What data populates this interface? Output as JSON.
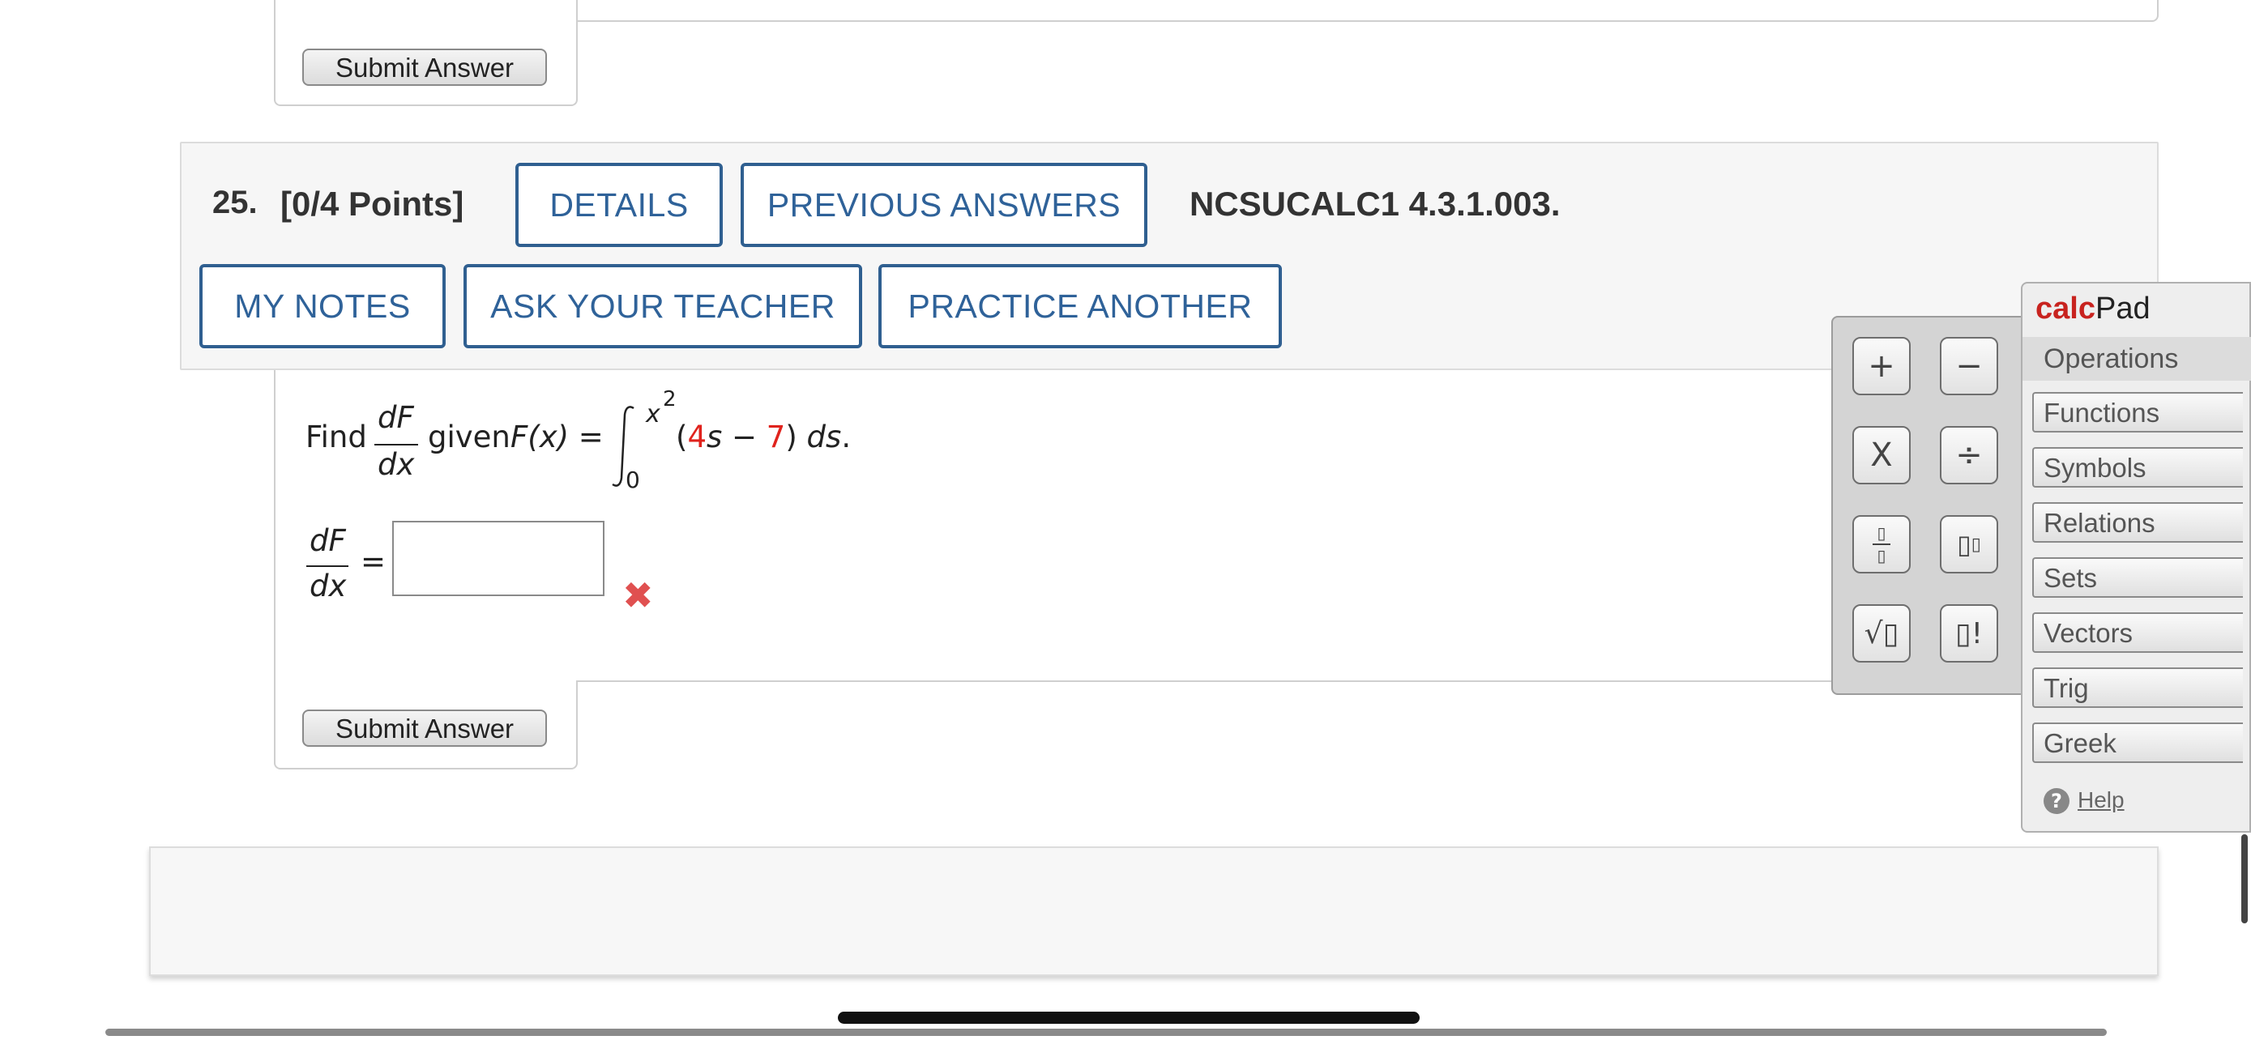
{
  "prev": {
    "submit_label": "Submit Answer"
  },
  "question": {
    "number": "25.",
    "points": "[0/4 Points]",
    "code": "NCSUCALC1 4.3.1.003.",
    "buttons": {
      "details": "DETAILS",
      "previous_answers": "PREVIOUS ANSWERS",
      "my_notes": "MY NOTES",
      "ask_teacher": "ASK YOUR TEACHER",
      "practice_another": "PRACTICE ANOTHER"
    },
    "prompt": {
      "find": "Find",
      "dF": "dF",
      "dx": "dx",
      "given": "given",
      "Fx": "F(x) =",
      "upper": "x",
      "upper_exp": "2",
      "lower": "0",
      "open": "(",
      "coef": "4",
      "var": "s",
      "minus": " − ",
      "const": "7",
      "close": ")",
      "ds": "ds",
      "period": "."
    },
    "answer": {
      "lhs_num": "dF",
      "lhs_den": "dx",
      "equals": "=",
      "value": "",
      "status": "incorrect"
    },
    "submit_label": "Submit Answer"
  },
  "calcpad": {
    "title_bold": "calc",
    "title_rest": "Pad",
    "active_tab": "Operations",
    "menu": [
      "Functions",
      "Symbols",
      "Relations",
      "Sets",
      "Vectors",
      "Trig",
      "Greek"
    ],
    "help": "Help",
    "keys": [
      {
        "name": "plus",
        "glyph": "+"
      },
      {
        "name": "minus",
        "glyph": "−"
      },
      {
        "name": "times",
        "glyph": "X"
      },
      {
        "name": "divide",
        "glyph": "÷"
      },
      {
        "name": "fraction",
        "glyph": "▯/▯"
      },
      {
        "name": "exponent",
        "glyph": "▯▯"
      },
      {
        "name": "sqrt",
        "glyph": "√▯"
      },
      {
        "name": "factorial",
        "glyph": "▯!"
      }
    ]
  }
}
